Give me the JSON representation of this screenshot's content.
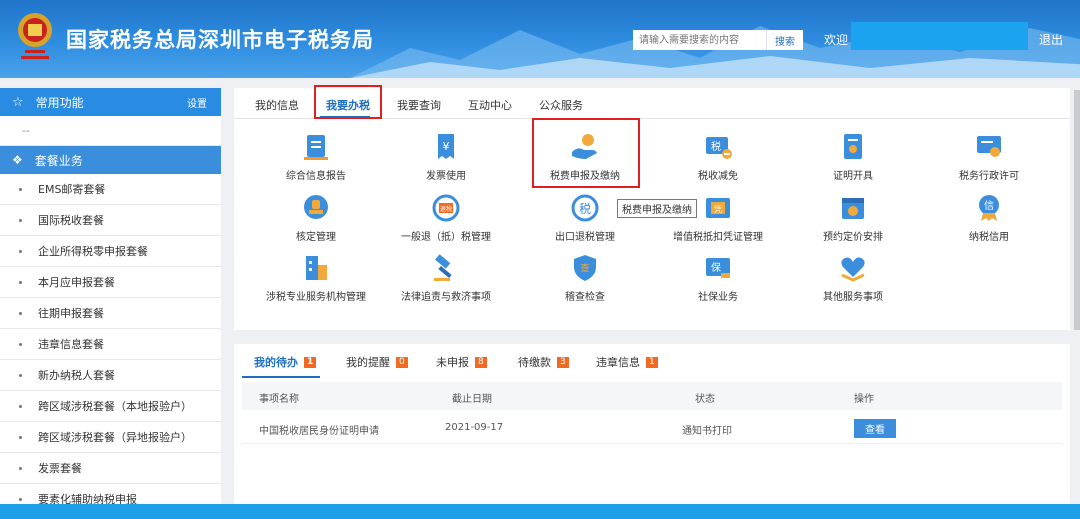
{
  "header": {
    "title": "国家税务总局深圳市电子税务局",
    "emblem_label": "中国税务",
    "search_placeholder": "请输入需要搜索的内容",
    "search_button": "搜索",
    "welcome": "欢迎 :",
    "logout": "退出"
  },
  "sidebar": {
    "common": "常用功能",
    "setting": "设置",
    "common_placeholder": "--",
    "packages": "套餐业务",
    "items": [
      "EMS邮寄套餐",
      "国际税收套餐",
      "企业所得税零申报套餐",
      "本月应申报套餐",
      "往期申报套餐",
      "违章信息套餐",
      "新办纳税人套餐",
      "跨区域涉税套餐（本地报验户）",
      "跨区域涉税套餐（异地报验户）",
      "发票套餐",
      "要素化辅助纳税申报"
    ]
  },
  "tabs": [
    "我的信息",
    "我要办税",
    "我要查询",
    "互动中心",
    "公众服务"
  ],
  "functions": [
    [
      "综合信息报告",
      "发票使用",
      "税费申报及缴纳",
      "税收减免",
      "证明开具",
      "税务行政许可"
    ],
    [
      "核定管理",
      "一般退（抵）税管理",
      "出口退税管理",
      "增值税抵扣凭证管理",
      "预约定价安排",
      "纳税信用"
    ],
    [
      "涉税专业服务机构管理",
      "法律追责与救济事项",
      "稽查检查",
      "社保业务",
      "其他服务事项"
    ]
  ],
  "icon_glyphs": {
    "tax": "税",
    "refund": "退税",
    "cert": "凭",
    "credit": "信",
    "social": "保",
    "inspect": "查",
    "money": "¥"
  },
  "tooltip": "税费申报及缴纳",
  "bottom_tabs": [
    {
      "label": "我的待办",
      "count": "1"
    },
    {
      "label": "我的提醒",
      "count": "0"
    },
    {
      "label": "未申报",
      "count": "8"
    },
    {
      "label": "待缴款",
      "count": "3"
    },
    {
      "label": "违章信息",
      "count": "1"
    }
  ],
  "table": {
    "headers": [
      "事项名称",
      "截止日期",
      "状态",
      "操作"
    ],
    "rows": [
      {
        "name": "中国税收居民身份证明申请",
        "deadline": "2021-09-17",
        "status": "通知书打印",
        "action": "查看"
      }
    ]
  },
  "colors": {
    "primary": "#1e6fc2",
    "accent": "#3b8edc",
    "badge": "#f26a22",
    "highlight": "#e02020"
  }
}
